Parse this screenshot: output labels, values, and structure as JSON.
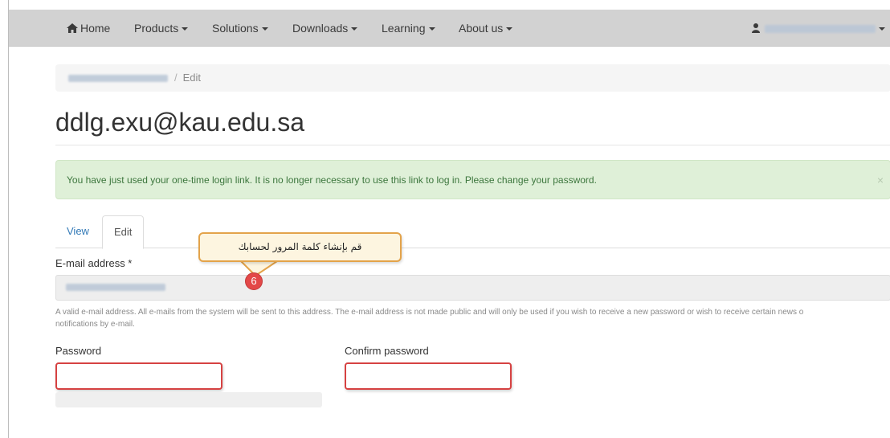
{
  "navbar": {
    "items": [
      {
        "label": "Home",
        "icon": "home-icon",
        "dropdown": false
      },
      {
        "label": "Products",
        "dropdown": true
      },
      {
        "label": "Solutions",
        "dropdown": true
      },
      {
        "label": "Downloads",
        "dropdown": true
      },
      {
        "label": "Learning",
        "dropdown": true
      },
      {
        "label": "About us",
        "dropdown": true
      }
    ],
    "user_icon": "user-icon"
  },
  "breadcrumb": {
    "current": "Edit"
  },
  "page_title": "ddlg.exu@kau.edu.sa",
  "alert": {
    "message": "You have just used your one-time login link. It is no longer necessary to use this link to log in. Please change your password.",
    "close": "×"
  },
  "tabs": [
    {
      "label": "View",
      "active": false
    },
    {
      "label": "Edit",
      "active": true
    }
  ],
  "form": {
    "email_label": "E-mail address *",
    "email_help_1": "A valid e-mail address. All e-mails from the system will be sent to this address. The e-mail address is not made public and will only be used if you wish to receive a new password or wish to receive certain news o",
    "email_help_2": "notifications by e-mail.",
    "password_label": "Password",
    "confirm_label": "Confirm password",
    "password_value": "",
    "confirm_value": ""
  },
  "annotation": {
    "text": "قم بإنشاء كلمة المرور لحسابك",
    "step": "6"
  },
  "colors": {
    "navbar_bg": "#d2d2d2",
    "alert_bg": "#dff0d8",
    "alert_text": "#3c763d",
    "link": "#337ab7",
    "highlight_border": "#d64242",
    "callout_border": "#e3a34a",
    "badge": "#e34848"
  }
}
